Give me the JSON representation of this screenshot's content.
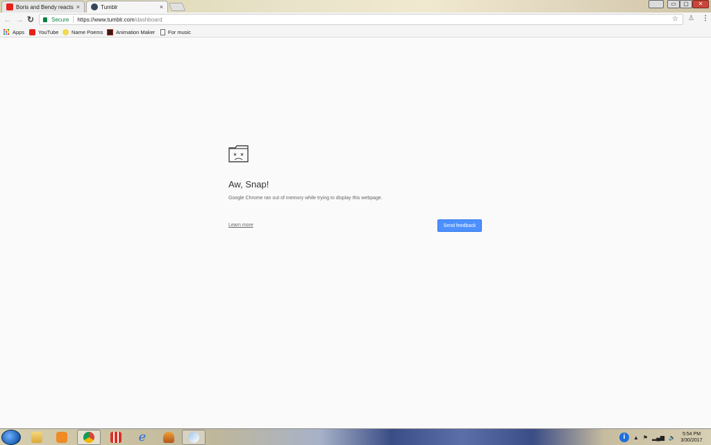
{
  "browser": {
    "tabs": [
      {
        "title": "Boris and Bendy reacts t",
        "close": "×",
        "favicon_color": "#e62117"
      },
      {
        "title": "Tumblr",
        "close": "×",
        "favicon_color": "#35465c"
      }
    ],
    "window_controls": {
      "minimize": "▭",
      "maximize": "▢",
      "close": "✕"
    },
    "omnibox": {
      "security_label": "Secure",
      "url_host": "https://www.tumblr.com",
      "url_path": "/dashboard"
    },
    "icons": {
      "back": "back-arrow-icon",
      "forward": "forward-arrow-icon",
      "reload": "reload-icon",
      "star": "bookmark-star-icon",
      "extension": "extension-icon",
      "menu": "kebab-menu-icon"
    }
  },
  "bookmarks": [
    {
      "label": "Apps",
      "icon": "apps-grid-icon"
    },
    {
      "label": "YouTube",
      "icon": "youtube-icon"
    },
    {
      "label": "Name Poems",
      "icon": "smiley-icon"
    },
    {
      "label": "Animation Maker",
      "icon": "film-icon"
    },
    {
      "label": "For music",
      "icon": "page-icon"
    }
  ],
  "error_page": {
    "title": "Aw, Snap!",
    "message": "Google Chrome ran out of memory while trying to display this webpage.",
    "learn_more": "Learn more",
    "send_feedback": "Send feedback",
    "button_color": "#4d90fe"
  },
  "taskbar": {
    "apps": [
      "start-orb-icon",
      "file-explorer-icon",
      "media-player-icon",
      "chrome-icon",
      "app-grid-icon",
      "internet-explorer-icon",
      "fl-studio-icon",
      "paint-icon"
    ],
    "clock_time": "5:54 PM",
    "clock_date": "3/30/2017"
  }
}
